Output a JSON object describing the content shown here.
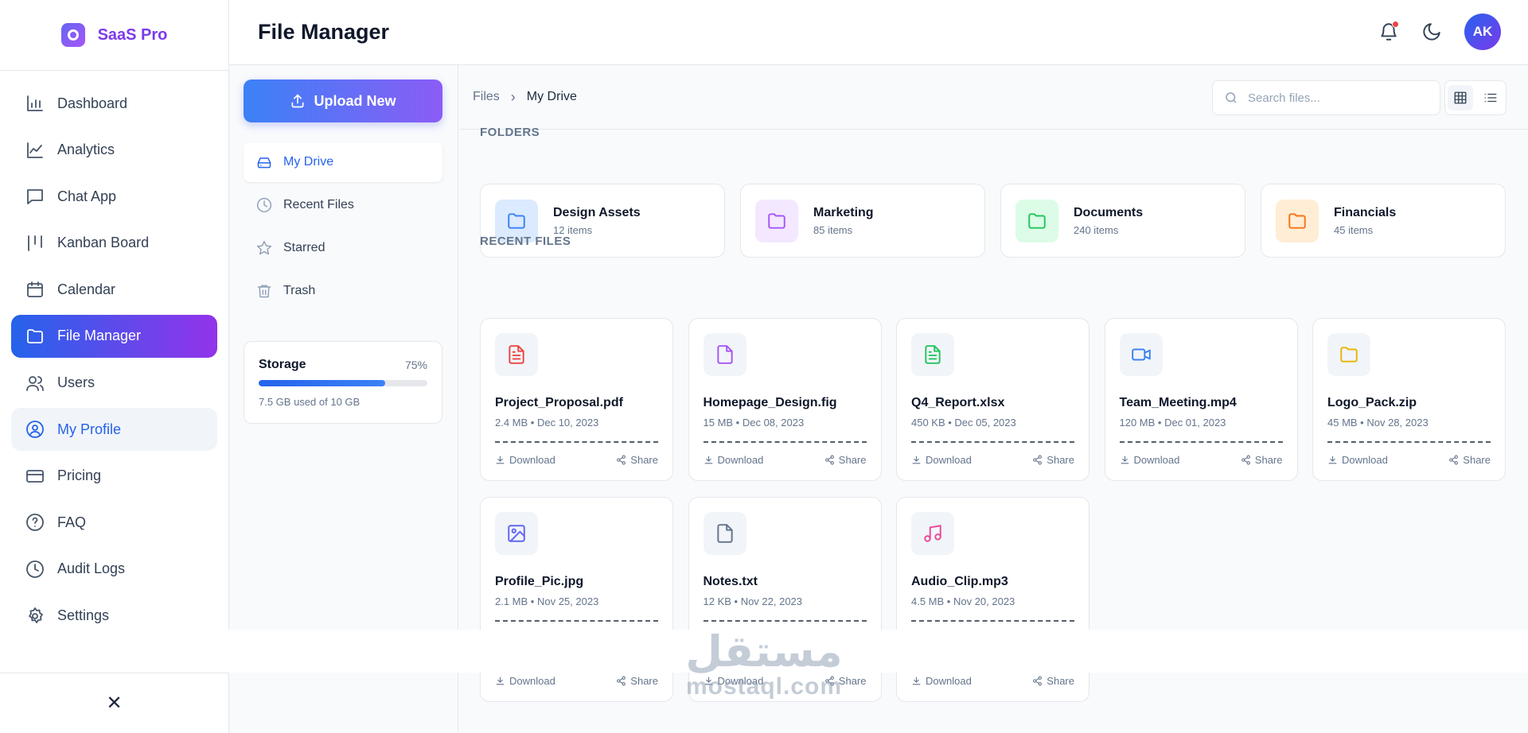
{
  "brand": {
    "name": "SaaS Pro"
  },
  "sidebar": {
    "items": [
      {
        "label": "Dashboard",
        "icon": "bar-chart-icon"
      },
      {
        "label": "Analytics",
        "icon": "line-chart-icon"
      },
      {
        "label": "Chat App",
        "icon": "chat-icon"
      },
      {
        "label": "Kanban Board",
        "icon": "kanban-icon"
      },
      {
        "label": "Calendar",
        "icon": "calendar-icon"
      },
      {
        "label": "File Manager",
        "icon": "folder-icon",
        "active": true
      },
      {
        "label": "Users",
        "icon": "users-icon"
      },
      {
        "label": "My Profile",
        "icon": "user-circle-icon"
      },
      {
        "label": "Pricing",
        "icon": "credit-card-icon"
      },
      {
        "label": "FAQ",
        "icon": "help-circle-icon"
      },
      {
        "label": "Audit Logs",
        "icon": "clock-icon"
      },
      {
        "label": "Settings",
        "icon": "gear-icon"
      }
    ],
    "close_glyph": "✕"
  },
  "header": {
    "title": "File Manager",
    "avatar_initials": "AK"
  },
  "upload": {
    "label": "Upload New"
  },
  "file_nav": [
    {
      "label": "My Drive",
      "icon": "drive-icon",
      "active": true
    },
    {
      "label": "Recent Files",
      "icon": "clock-icon"
    },
    {
      "label": "Starred",
      "icon": "star-icon"
    },
    {
      "label": "Trash",
      "icon": "trash-icon"
    }
  ],
  "storage": {
    "title": "Storage",
    "percent_label": "75%",
    "fraction": 0.75,
    "used_label": "7.5 GB used of 10 GB"
  },
  "breadcrumb": {
    "root": "Files",
    "separator": "›",
    "current": "My Drive"
  },
  "search": {
    "placeholder": "Search files..."
  },
  "folders_label": "FOLDERS",
  "folders": [
    {
      "name": "Design Assets",
      "count": "12 items",
      "color": "#3b82f6",
      "bg": "#dbeafe"
    },
    {
      "name": "Marketing",
      "count": "85 items",
      "color": "#a855f7",
      "bg": "#f3e8ff"
    },
    {
      "name": "Documents",
      "count": "240 items",
      "color": "#22c55e",
      "bg": "#dcfce7"
    },
    {
      "name": "Financials",
      "count": "45 items",
      "color": "#f97316",
      "bg": "#ffedd5"
    }
  ],
  "recent_label": "RECENT FILES",
  "files": [
    {
      "name": "Project_Proposal.pdf",
      "meta": "2.4 MB • Dec 10, 2023",
      "icon": "pdf-file-icon",
      "color": "#ef4444"
    },
    {
      "name": "Homepage_Design.fig",
      "meta": "15 MB • Dec 08, 2023",
      "icon": "design-file-icon",
      "color": "#a855f7"
    },
    {
      "name": "Q4_Report.xlsx",
      "meta": "450 KB • Dec 05, 2023",
      "icon": "spreadsheet-file-icon",
      "color": "#22c55e"
    },
    {
      "name": "Team_Meeting.mp4",
      "meta": "120 MB • Dec 01, 2023",
      "icon": "video-icon",
      "color": "#3b82f6"
    },
    {
      "name": "Logo_Pack.zip",
      "meta": "45 MB • Nov 28, 2023",
      "icon": "archive-folder-icon",
      "color": "#eab308"
    },
    {
      "name": "Profile_Pic.jpg",
      "meta": "2.1 MB • Nov 25, 2023",
      "icon": "image-icon",
      "color": "#6366f1"
    },
    {
      "name": "Notes.txt",
      "meta": "12 KB • Nov 22, 2023",
      "icon": "text-file-icon",
      "color": "#64748b"
    },
    {
      "name": "Audio_Clip.mp3",
      "meta": "4.5 MB • Nov 20, 2023",
      "icon": "music-icon",
      "color": "#ec4899"
    }
  ],
  "actions": {
    "download": "Download",
    "share": "Share"
  },
  "watermark": {
    "arabic": "مستقل",
    "latin": "mostaql.com"
  }
}
